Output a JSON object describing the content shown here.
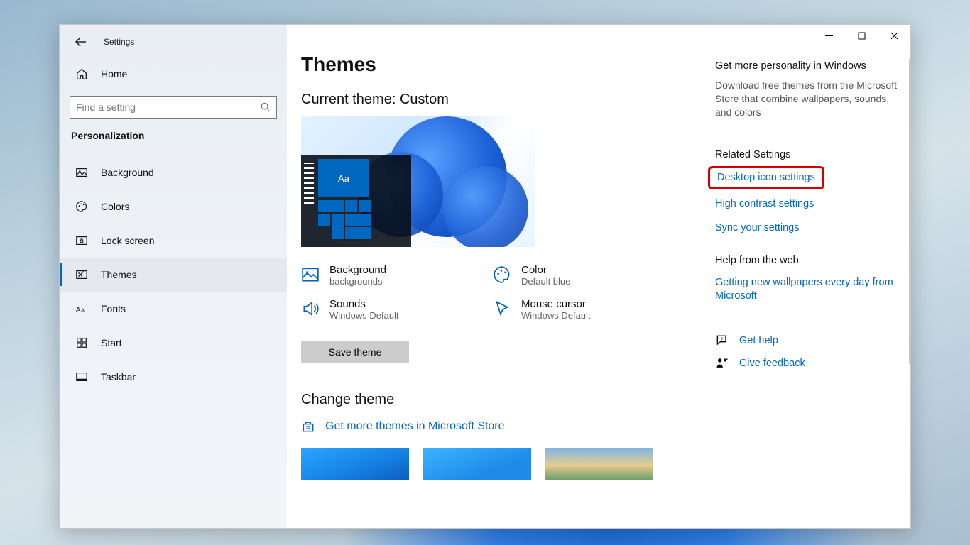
{
  "window": {
    "title": "Settings"
  },
  "nav": {
    "home": "Home",
    "search_placeholder": "Find a setting",
    "section": "Personalization",
    "items": [
      {
        "label": "Background"
      },
      {
        "label": "Colors"
      },
      {
        "label": "Lock screen"
      },
      {
        "label": "Themes"
      },
      {
        "label": "Fonts"
      },
      {
        "label": "Start"
      },
      {
        "label": "Taskbar"
      }
    ]
  },
  "page": {
    "title": "Themes",
    "current_theme_label": "Current theme: Custom",
    "preview_tile_text": "Aa",
    "options": [
      {
        "title": "Background",
        "sub": "backgrounds"
      },
      {
        "title": "Color",
        "sub": "Default blue"
      },
      {
        "title": "Sounds",
        "sub": "Windows Default"
      },
      {
        "title": "Mouse cursor",
        "sub": "Windows Default"
      }
    ],
    "save_button": "Save theme",
    "change_theme": "Change theme",
    "store_link": "Get more themes in Microsoft Store"
  },
  "aside": {
    "promo_title": "Get more personality in Windows",
    "promo_body": "Download free themes from the Microsoft Store that combine wallpapers, sounds, and colors",
    "related_heading": "Related Settings",
    "links": {
      "desktop_icons": "Desktop icon settings",
      "high_contrast": "High contrast settings",
      "sync": "Sync your settings"
    },
    "help_heading": "Help from the web",
    "help_link": "Getting new wallpapers every day from Microsoft",
    "get_help": "Get help",
    "feedback": "Give feedback"
  }
}
